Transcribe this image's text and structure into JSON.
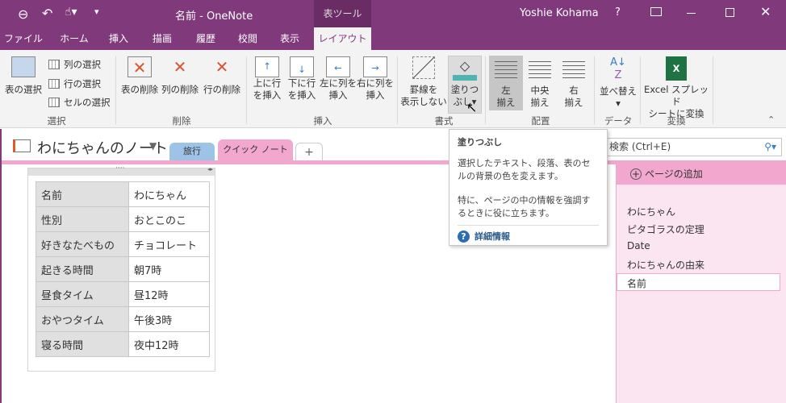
{
  "titlebar": {
    "title": "名前 - OneNote",
    "context_tab": "表ツール",
    "user": "Yoshie Kohama",
    "help": "?",
    "icons": [
      "back-icon",
      "undo-icon",
      "touch-mode-icon",
      "customize-qat-icon",
      "ribbon-display-icon",
      "minimize-icon",
      "maximize-icon",
      "close-icon"
    ]
  },
  "tabs": [
    "ファイル",
    "ホーム",
    "挿入",
    "描画",
    "履歴",
    "校閲",
    "表示",
    "レイアウト"
  ],
  "ribbon": {
    "select": {
      "label": "選択",
      "table": "表の選択",
      "col": "列の選択",
      "row": "行の選択",
      "cell": "セルの選択"
    },
    "delete": {
      "label": "削除",
      "table": "表の削除",
      "col": "列の削除",
      "row": "行の削除"
    },
    "insert": {
      "label": "挿入",
      "above": [
        "上に行",
        "を挿入"
      ],
      "below": [
        "下に行",
        "を挿入"
      ],
      "left": [
        "左に列を",
        "挿入"
      ],
      "right": [
        "右に列を",
        "挿入"
      ]
    },
    "format": {
      "label": "書式",
      "borders": [
        "罫線を",
        "表示しない"
      ],
      "shading": [
        "塗りつ",
        "ぶし"
      ]
    },
    "align": {
      "label": "配置",
      "left": [
        "左",
        "揃え"
      ],
      "center": [
        "中央",
        "揃え"
      ],
      "right": [
        "右",
        "揃え"
      ]
    },
    "data": {
      "label": "データ",
      "sort": "並べ替え"
    },
    "convert": {
      "label": "変換",
      "excel": [
        "Excel スプレッド",
        "シートに変換"
      ]
    }
  },
  "notebook": {
    "name": "わにちゃんのノート",
    "sections": [
      "旅行",
      "クイック ノート",
      "+"
    ],
    "colors": {
      "travel": "#9dc3e6",
      "quick": "#f2a7cf"
    }
  },
  "search": {
    "placeholder": "検索 (Ctrl+E)"
  },
  "tooltip": {
    "title": "塗りつぶし",
    "body1": "選択したテキスト、段落、表のセルの背景の色を変えます。",
    "body2": "特に、ページの中の情報を強調するときに役に立ちます。",
    "more": "詳細情報"
  },
  "pages": {
    "add": "ページの追加",
    "items": [
      "わにちゃん",
      "ピタゴラスの定理",
      "Date",
      "わにちゃんの由来",
      "名前"
    ]
  },
  "table": [
    [
      "名前",
      "わにちゃん"
    ],
    [
      "性別",
      "おとこのこ"
    ],
    [
      "好きなたべもの",
      "チョコレート"
    ],
    [
      "起きる時間",
      "朝7時"
    ],
    [
      "昼食タイム",
      "昼12時"
    ],
    [
      "おやつタイム",
      "午後3時"
    ],
    [
      "寝る時間",
      "夜中12時"
    ]
  ]
}
